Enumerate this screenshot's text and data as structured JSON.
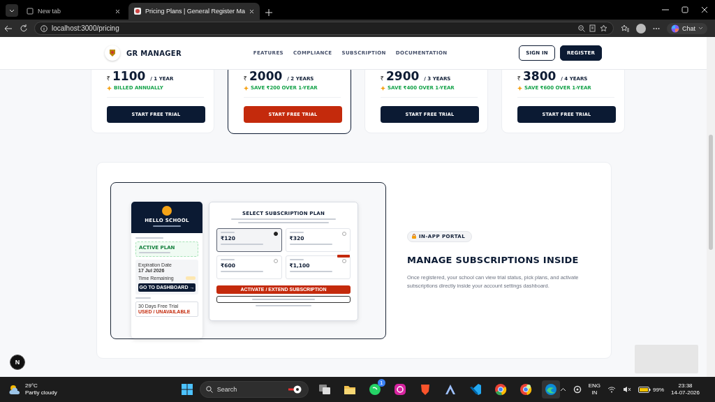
{
  "browser": {
    "tabs": [
      {
        "title": "New tab",
        "selected": false
      },
      {
        "title": "Pricing Plans | General Register Ma",
        "selected": true
      }
    ],
    "url": "localhost:3000/pricing",
    "chat_label": "Chat"
  },
  "header": {
    "brand": "GR MANAGER",
    "nav": [
      "FEATURES",
      "COMPLIANCE",
      "SUBSCRIPTION",
      "DOCUMENTATION"
    ],
    "sign_in": "SIGN IN",
    "register": "REGISTER"
  },
  "plans": [
    {
      "currency": "₹",
      "price": "1100",
      "period": "/ 1 YEAR",
      "note": "BILLED ANNUALLY",
      "button": "START FREE TRIAL",
      "selected": false
    },
    {
      "currency": "₹",
      "price": "2000",
      "period": "/ 2 YEARS",
      "note": "SAVE ₹200 OVER 1-YEAR",
      "button": "START FREE TRIAL",
      "selected": true
    },
    {
      "currency": "₹",
      "price": "2900",
      "period": "/ 3 YEARS",
      "note": "SAVE ₹400 OVER 1-YEAR",
      "button": "START FREE TRIAL",
      "selected": false
    },
    {
      "currency": "₹",
      "price": "3800",
      "period": "/ 4 YEARS",
      "note": "SAVE ₹600 OVER 1-YEAR",
      "button": "START FREE TRIAL",
      "selected": false
    }
  ],
  "portal": {
    "preview": {
      "school": "HELLO SCHOOL",
      "active_plan": "ACTIVE PLAN",
      "expiration_label": "Expiration Date",
      "expiration_value": "17 Jul 2026",
      "remaining_label": "Time Remaining",
      "trial_label": "30 Days Free Trial",
      "trial_status": "USED / UNAVAILABLE",
      "dashboard_button": "GO TO DASHBOARD →",
      "title": "SELECT SUBSCRIPTION PLAN",
      "options": [
        {
          "price": "₹120",
          "selected": true,
          "tagged": false
        },
        {
          "price": "₹320",
          "selected": false,
          "tagged": false
        },
        {
          "price": "₹600",
          "selected": false,
          "tagged": false
        },
        {
          "price": "₹1,100",
          "selected": false,
          "tagged": true
        }
      ],
      "activate_button": "ACTIVATE / EXTEND SUBSCRIPTION"
    },
    "badge": "IN-APP PORTAL",
    "heading": "MANAGE SUBSCRIPTIONS INSIDE",
    "text": "Once registered, your school can view trial status, pick plans, and activate subscriptions directly inside your account settings dashboard."
  },
  "dev_indicator": "N",
  "taskbar": {
    "temperature": "29°C",
    "condition": "Partly cloudy",
    "search_placeholder": "Search",
    "apps": [
      {
        "kind": "taskview",
        "active": false
      },
      {
        "kind": "folder",
        "active": false
      },
      {
        "kind": "chat",
        "active": false,
        "badge": "1"
      },
      {
        "kind": "camera",
        "active": false
      },
      {
        "kind": "shield",
        "active": false
      },
      {
        "kind": "peak",
        "active": false
      },
      {
        "kind": "code",
        "active": false
      },
      {
        "kind": "wheel",
        "active": false
      },
      {
        "kind": "wheel2",
        "active": false
      },
      {
        "kind": "wave",
        "active": true
      }
    ],
    "language": "ENG",
    "region": "IN",
    "battery": "99%",
    "time": "23:38",
    "date": "14-07-2026"
  }
}
